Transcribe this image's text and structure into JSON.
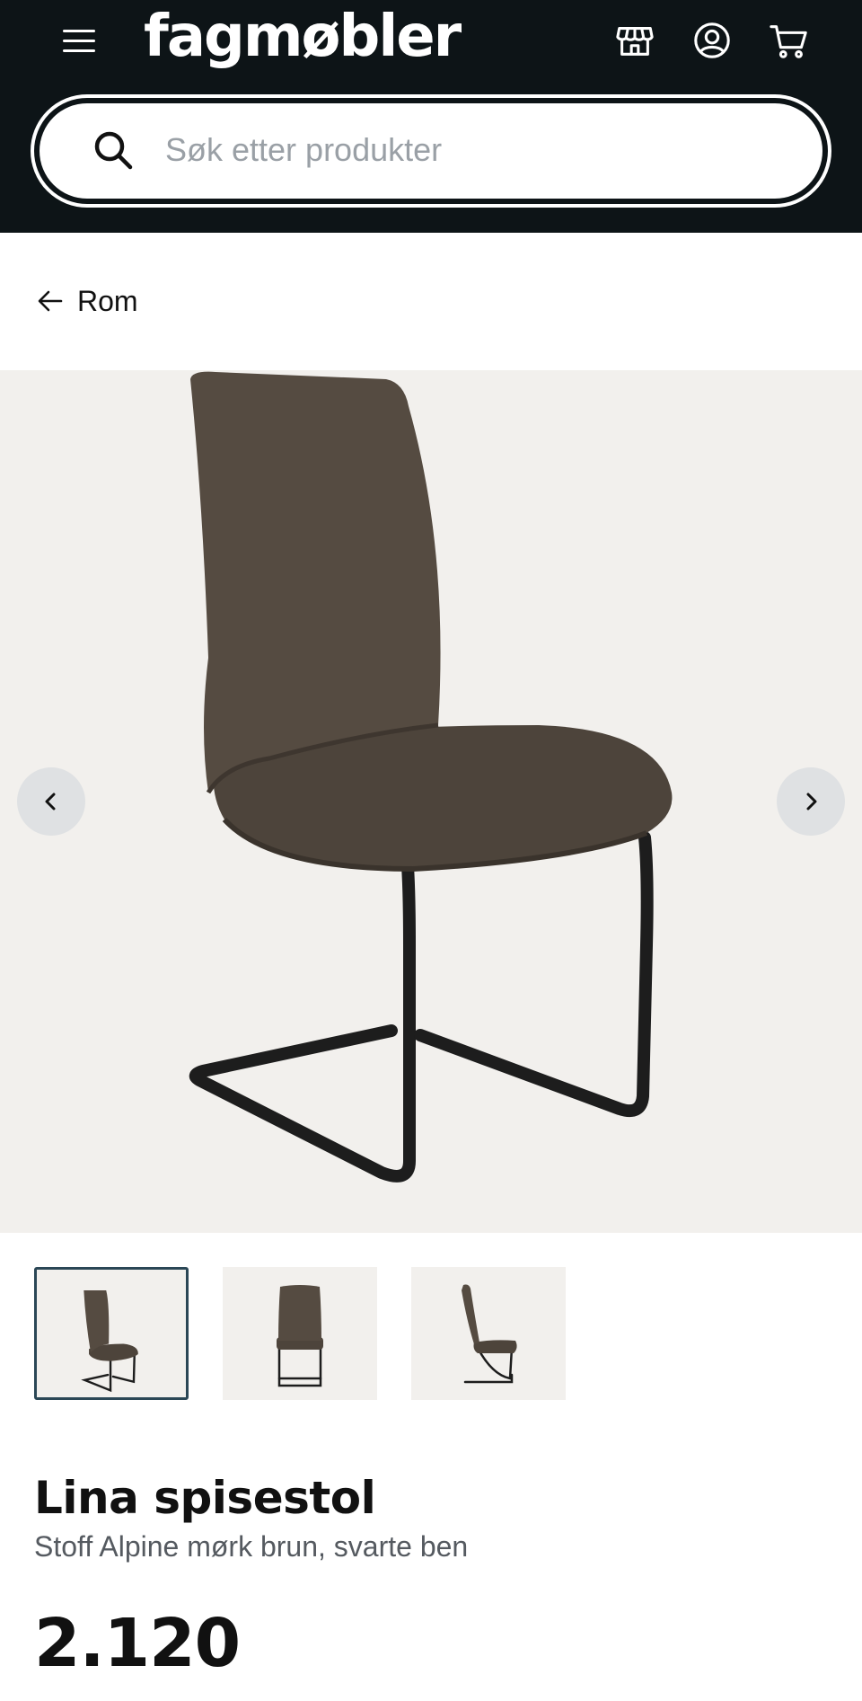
{
  "header": {
    "logo": "fagmøbler",
    "icons": [
      "store-icon",
      "account-icon",
      "cart-icon"
    ],
    "background": "#0d1417"
  },
  "search": {
    "placeholder": "Søk etter produkter"
  },
  "breadcrumb": {
    "back_label": "Rom"
  },
  "gallery": {
    "background": "#f2f0ed",
    "image_count": 3,
    "active_index": 1
  },
  "product": {
    "title": "Lina spisestol",
    "subtitle": "Stoff Alpine mørk brun, svarte ben",
    "price": "2.120"
  },
  "colors": {
    "fabric": "#4d443b",
    "legs": "#1d1d1d",
    "thumb_active_border": "#2b4756"
  }
}
